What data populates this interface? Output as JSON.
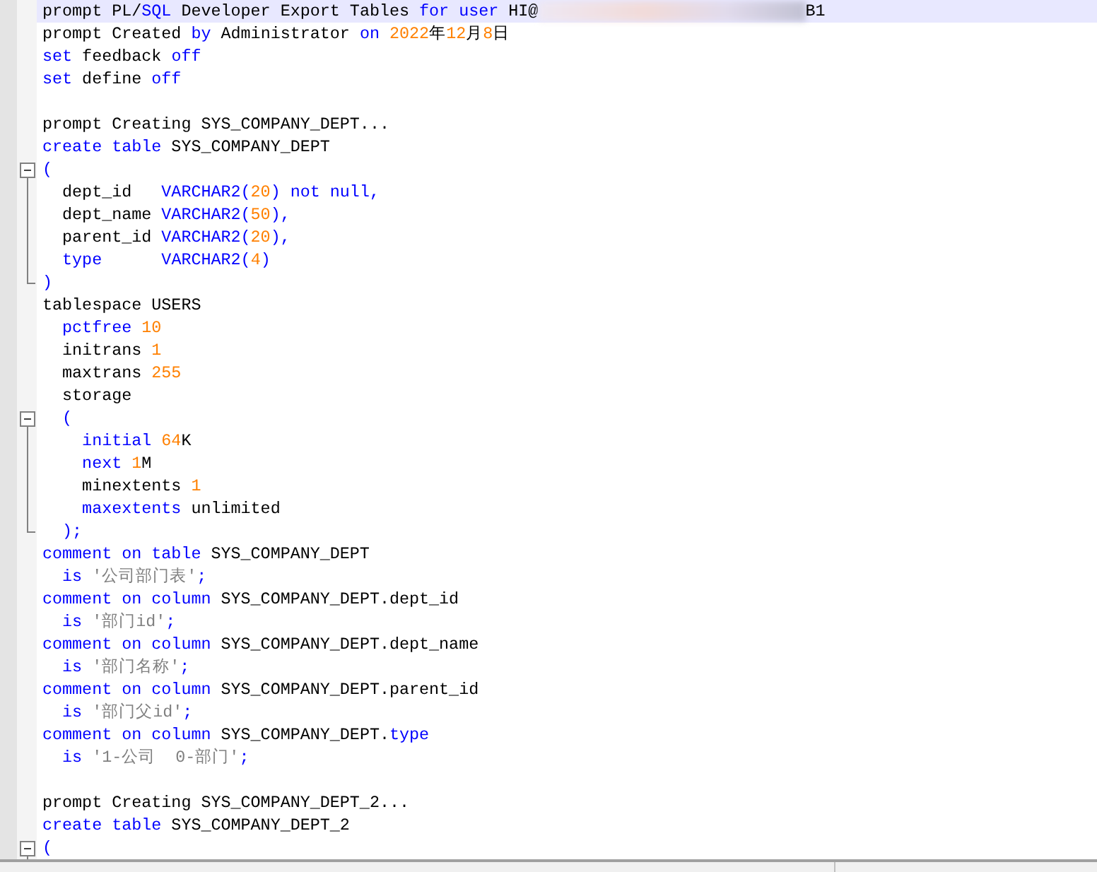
{
  "editor": {
    "lines": [
      {
        "current": true,
        "kind": "plain",
        "tokens": [
          {
            "kind": "plain",
            "text": "prompt PL/"
          },
          {
            "kind": "kw",
            "text": "SQL"
          },
          {
            "kind": "plain",
            "text": " Developer Export Tables "
          },
          {
            "kind": "kw",
            "text": "for user"
          },
          {
            "kind": "plain",
            "text": " HI@"
          },
          {
            "kind": "redacted"
          },
          {
            "kind": "plain",
            "text": "B1"
          }
        ]
      },
      {
        "current": false,
        "kind": "plain",
        "tokens": [
          {
            "kind": "plain",
            "text": "prompt Created "
          },
          {
            "kind": "kw",
            "text": "by"
          },
          {
            "kind": "plain",
            "text": " Administrator "
          },
          {
            "kind": "kw",
            "text": "on"
          },
          {
            "kind": "num",
            "text": " 2022"
          },
          {
            "kind": "plain",
            "text": "年"
          },
          {
            "kind": "num",
            "text": "12"
          },
          {
            "kind": "plain",
            "text": "月"
          },
          {
            "kind": "num",
            "text": "8"
          },
          {
            "kind": "plain",
            "text": "日"
          }
        ]
      },
      {
        "current": false,
        "kind": "plain",
        "tokens": [
          {
            "kind": "kw",
            "text": "set"
          },
          {
            "kind": "plain",
            "text": " feedback "
          },
          {
            "kind": "kw",
            "text": "off"
          }
        ]
      },
      {
        "current": false,
        "kind": "plain",
        "tokens": [
          {
            "kind": "kw",
            "text": "set"
          },
          {
            "kind": "plain",
            "text": " define "
          },
          {
            "kind": "kw",
            "text": "off"
          }
        ]
      },
      {
        "current": false,
        "kind": "plain"
      },
      {
        "current": false,
        "kind": "plain",
        "tokens": [
          {
            "kind": "plain",
            "text": "prompt Creating SYS_COMPANY_DEPT..."
          }
        ]
      },
      {
        "current": false,
        "kind": "plain",
        "tokens": [
          {
            "kind": "kw",
            "text": "create table"
          },
          {
            "kind": "plain",
            "text": " SYS_COMPANY_DEPT"
          }
        ]
      },
      {
        "current": false,
        "kind": "foldstart",
        "tokens": [
          {
            "kind": "kw",
            "text": "("
          }
        ]
      },
      {
        "current": false,
        "kind": "foldbody",
        "tokens": [
          {
            "kind": "plain",
            "text": "  dept_id   "
          },
          {
            "kind": "kw",
            "text": "VARCHAR2("
          },
          {
            "kind": "num",
            "text": "20"
          },
          {
            "kind": "kw",
            "text": ") not null,"
          }
        ]
      },
      {
        "current": false,
        "kind": "foldbody",
        "tokens": [
          {
            "kind": "plain",
            "text": "  dept_name "
          },
          {
            "kind": "kw",
            "text": "VARCHAR2("
          },
          {
            "kind": "num",
            "text": "50"
          },
          {
            "kind": "kw",
            "text": "),"
          }
        ]
      },
      {
        "current": false,
        "kind": "foldbody",
        "tokens": [
          {
            "kind": "plain",
            "text": "  parent_id "
          },
          {
            "kind": "kw",
            "text": "VARCHAR2("
          },
          {
            "kind": "num",
            "text": "20"
          },
          {
            "kind": "kw",
            "text": "),"
          }
        ]
      },
      {
        "current": false,
        "kind": "foldbody",
        "tokens": [
          {
            "kind": "kw",
            "text": "  type"
          },
          {
            "kind": "kw",
            "text": "      VARCHAR2("
          },
          {
            "kind": "num",
            "text": "4"
          },
          {
            "kind": "kw",
            "text": ")"
          }
        ]
      },
      {
        "current": false,
        "kind": "foldend",
        "tokens": [
          {
            "kind": "kw",
            "text": ")"
          }
        ]
      },
      {
        "current": false,
        "kind": "plain",
        "tokens": [
          {
            "kind": "plain",
            "text": "tablespace USERS"
          }
        ]
      },
      {
        "current": false,
        "kind": "plain",
        "tokens": [
          {
            "kind": "kw",
            "text": "  pctfree"
          },
          {
            "kind": "num",
            "text": " 10"
          }
        ]
      },
      {
        "current": false,
        "kind": "plain",
        "tokens": [
          {
            "kind": "plain",
            "text": "  initrans "
          },
          {
            "kind": "num",
            "text": "1"
          }
        ]
      },
      {
        "current": false,
        "kind": "plain",
        "tokens": [
          {
            "kind": "plain",
            "text": "  maxtrans "
          },
          {
            "kind": "num",
            "text": "255"
          }
        ]
      },
      {
        "current": false,
        "kind": "plain",
        "tokens": [
          {
            "kind": "plain",
            "text": "  storage"
          }
        ]
      },
      {
        "current": false,
        "kind": "foldstart",
        "tokens": [
          {
            "kind": "kw",
            "text": "  ("
          }
        ]
      },
      {
        "current": false,
        "kind": "foldbody",
        "tokens": [
          {
            "kind": "kw",
            "text": "    initial"
          },
          {
            "kind": "num",
            "text": " 64"
          },
          {
            "kind": "plain",
            "text": "K"
          }
        ]
      },
      {
        "current": false,
        "kind": "foldbody",
        "tokens": [
          {
            "kind": "kw",
            "text": "    next"
          },
          {
            "kind": "num",
            "text": " 1"
          },
          {
            "kind": "plain",
            "text": "M"
          }
        ]
      },
      {
        "current": false,
        "kind": "foldbody",
        "tokens": [
          {
            "kind": "plain",
            "text": "    minextents "
          },
          {
            "kind": "num",
            "text": "1"
          }
        ]
      },
      {
        "current": false,
        "kind": "foldbody",
        "tokens": [
          {
            "kind": "kw",
            "text": "    maxextents"
          },
          {
            "kind": "plain",
            "text": " unlimited"
          }
        ]
      },
      {
        "current": false,
        "kind": "foldend",
        "tokens": [
          {
            "kind": "kw",
            "text": "  );"
          }
        ]
      },
      {
        "current": false,
        "kind": "plain",
        "tokens": [
          {
            "kind": "kw",
            "text": "comment on table"
          },
          {
            "kind": "plain",
            "text": " SYS_COMPANY_DEPT"
          }
        ]
      },
      {
        "current": false,
        "kind": "plain",
        "tokens": [
          {
            "kind": "kw",
            "text": "  is"
          },
          {
            "kind": "str",
            "text": " '公司部门表'"
          },
          {
            "kind": "kw",
            "text": ";"
          }
        ]
      },
      {
        "current": false,
        "kind": "plain",
        "tokens": [
          {
            "kind": "kw",
            "text": "comment on column"
          },
          {
            "kind": "plain",
            "text": " SYS_COMPANY_DEPT.dept_id"
          }
        ]
      },
      {
        "current": false,
        "kind": "plain",
        "tokens": [
          {
            "kind": "kw",
            "text": "  is"
          },
          {
            "kind": "str",
            "text": " '部门id'"
          },
          {
            "kind": "kw",
            "text": ";"
          }
        ]
      },
      {
        "current": false,
        "kind": "plain",
        "tokens": [
          {
            "kind": "kw",
            "text": "comment on column"
          },
          {
            "kind": "plain",
            "text": " SYS_COMPANY_DEPT.dept_name"
          }
        ]
      },
      {
        "current": false,
        "kind": "plain",
        "tokens": [
          {
            "kind": "kw",
            "text": "  is"
          },
          {
            "kind": "str",
            "text": " '部门名称'"
          },
          {
            "kind": "kw",
            "text": ";"
          }
        ]
      },
      {
        "current": false,
        "kind": "plain",
        "tokens": [
          {
            "kind": "kw",
            "text": "comment on column"
          },
          {
            "kind": "plain",
            "text": " SYS_COMPANY_DEPT.parent_id"
          }
        ]
      },
      {
        "current": false,
        "kind": "plain",
        "tokens": [
          {
            "kind": "kw",
            "text": "  is"
          },
          {
            "kind": "str",
            "text": " '部门父id'"
          },
          {
            "kind": "kw",
            "text": ";"
          }
        ]
      },
      {
        "current": false,
        "kind": "plain",
        "tokens": [
          {
            "kind": "kw",
            "text": "comment on column"
          },
          {
            "kind": "plain",
            "text": " SYS_COMPANY_DEPT."
          },
          {
            "kind": "kw",
            "text": "type"
          }
        ]
      },
      {
        "current": false,
        "kind": "plain",
        "tokens": [
          {
            "kind": "kw",
            "text": "  is"
          },
          {
            "kind": "str",
            "text": " '1-公司  0-部门'"
          },
          {
            "kind": "kw",
            "text": ";"
          }
        ]
      },
      {
        "current": false,
        "kind": "plain"
      },
      {
        "current": false,
        "kind": "plain",
        "tokens": [
          {
            "kind": "plain",
            "text": "prompt Creating SYS_COMPANY_DEPT_2..."
          }
        ]
      },
      {
        "current": false,
        "kind": "plain",
        "tokens": [
          {
            "kind": "kw",
            "text": "create table"
          },
          {
            "kind": "plain",
            "text": " SYS_COMPANY_DEPT_2"
          }
        ]
      },
      {
        "current": false,
        "kind": "foldstart",
        "tokens": [
          {
            "kind": "kw",
            "text": "("
          }
        ]
      }
    ]
  }
}
